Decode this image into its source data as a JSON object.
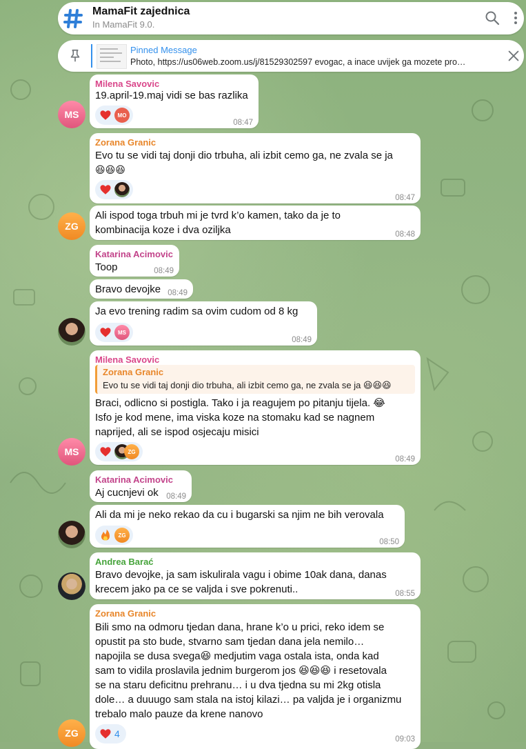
{
  "header": {
    "title": "MamaFit zajednica",
    "subtitle": "In MamaFit 9.0.",
    "icons": [
      "hash-icon",
      "search-icon",
      "more-vertical-icon"
    ]
  },
  "pinned": {
    "label": "Pinned Message",
    "text": "Photo, https://us06web.zoom.us/j/81529302597 evogac, a inace uvijek ga mozete pro…",
    "icons": [
      "pin-icon",
      "close-icon"
    ]
  },
  "colors": {
    "accent": "#3390ec",
    "milena": "#d9468a",
    "zorana": "#e8862a",
    "katarina": "#c2438a",
    "andrea": "#45a33a"
  },
  "messages": [
    {
      "sender": "Milena Savovic",
      "text": "19.april-19.maj vidi se bas razlika",
      "time": "08:47",
      "reactions": [
        "heart",
        "MO"
      ]
    },
    {
      "sender": "Zorana Granic",
      "text": "Evo tu se vidi taj donji dio trbuha, ali izbit cemo ga, ne zvala se ja",
      "emoji": "😆😆😆",
      "time": "08:47",
      "reactions": [
        "heart",
        "photo"
      ]
    },
    {
      "text_lines": [
        "Ali ispod toga trbuh mi je tvrd k’o kamen, tako da je to",
        "kombinacija koze i dva oziljka"
      ],
      "time": "08:48",
      "avatar": "ZG"
    },
    {
      "sender": "Katarina Acimovic",
      "text": "Toop",
      "time": "08:49"
    },
    {
      "text": "Bravo devojke",
      "time": "08:49"
    },
    {
      "text": "Ja evo trening radim sa ovim cudom od 8 kg",
      "time": "08:49",
      "reactions": [
        "heart",
        "MS"
      ]
    },
    {
      "sender": "Milena Savovic",
      "quote": {
        "name": "Zorana Granic",
        "text": "Evo tu se vidi taj donji dio trbuha, ali izbit cemo ga, ne zvala se ja 😆😆😆"
      },
      "text_lines": [
        "Braci, odlicno si postigla. Tako i ja reagujem po pitanju tijela. 😂",
        "Isfo je kod mene, ima viska koze na stomaku kad se nagnem",
        "naprijed, ali se ispod osjecaju misici"
      ],
      "time": "08:49",
      "avatar": "MS",
      "reactions": [
        "heart",
        "photo",
        "ZG"
      ]
    },
    {
      "sender": "Katarina Acimovic",
      "text": "Aj cucnjevi ok",
      "time": "08:49"
    },
    {
      "text": "Ali da mi je neko rekao da cu i bugarski sa njim ne bih verovala",
      "time": "08:50",
      "reactions": [
        "fire",
        "ZG"
      ]
    },
    {
      "sender": "Andrea Barać",
      "text_lines": [
        "Bravo devojke, ja sam iskulirala vagu i obime 10ak dana, danas",
        "krecem jako pa ce se valjda i sve pokrenuti.."
      ],
      "time": "08:55"
    },
    {
      "sender": "Zorana Granic",
      "text_lines": [
        "Bili smo na odmoru tjedan dana, hrane k’o u prici, reko idem se",
        "opustit pa sto bude, stvarno sam tjedan dana jela nemilo…",
        "napojila se dusa svega😆 medjutim vaga ostala ista, onda kad",
        "sam to vidila proslavila jednim burgerom jos 😆😆😆 i resetovala",
        "se na staru deficitnu prehranu… i u dva tjedna su mi 2kg otisla",
        "dole… a duuugo sam stala na istoj kilazi… pa valjda je i organizmu",
        "trebalo malo pauze da krene nanovo"
      ],
      "time": "09:03",
      "avatar": "ZG",
      "reactions": [
        {
          "type": "heart",
          "count": "4"
        }
      ]
    }
  ],
  "avatars": {
    "ms": "MS",
    "zg": "ZG",
    "mo": "MO"
  }
}
